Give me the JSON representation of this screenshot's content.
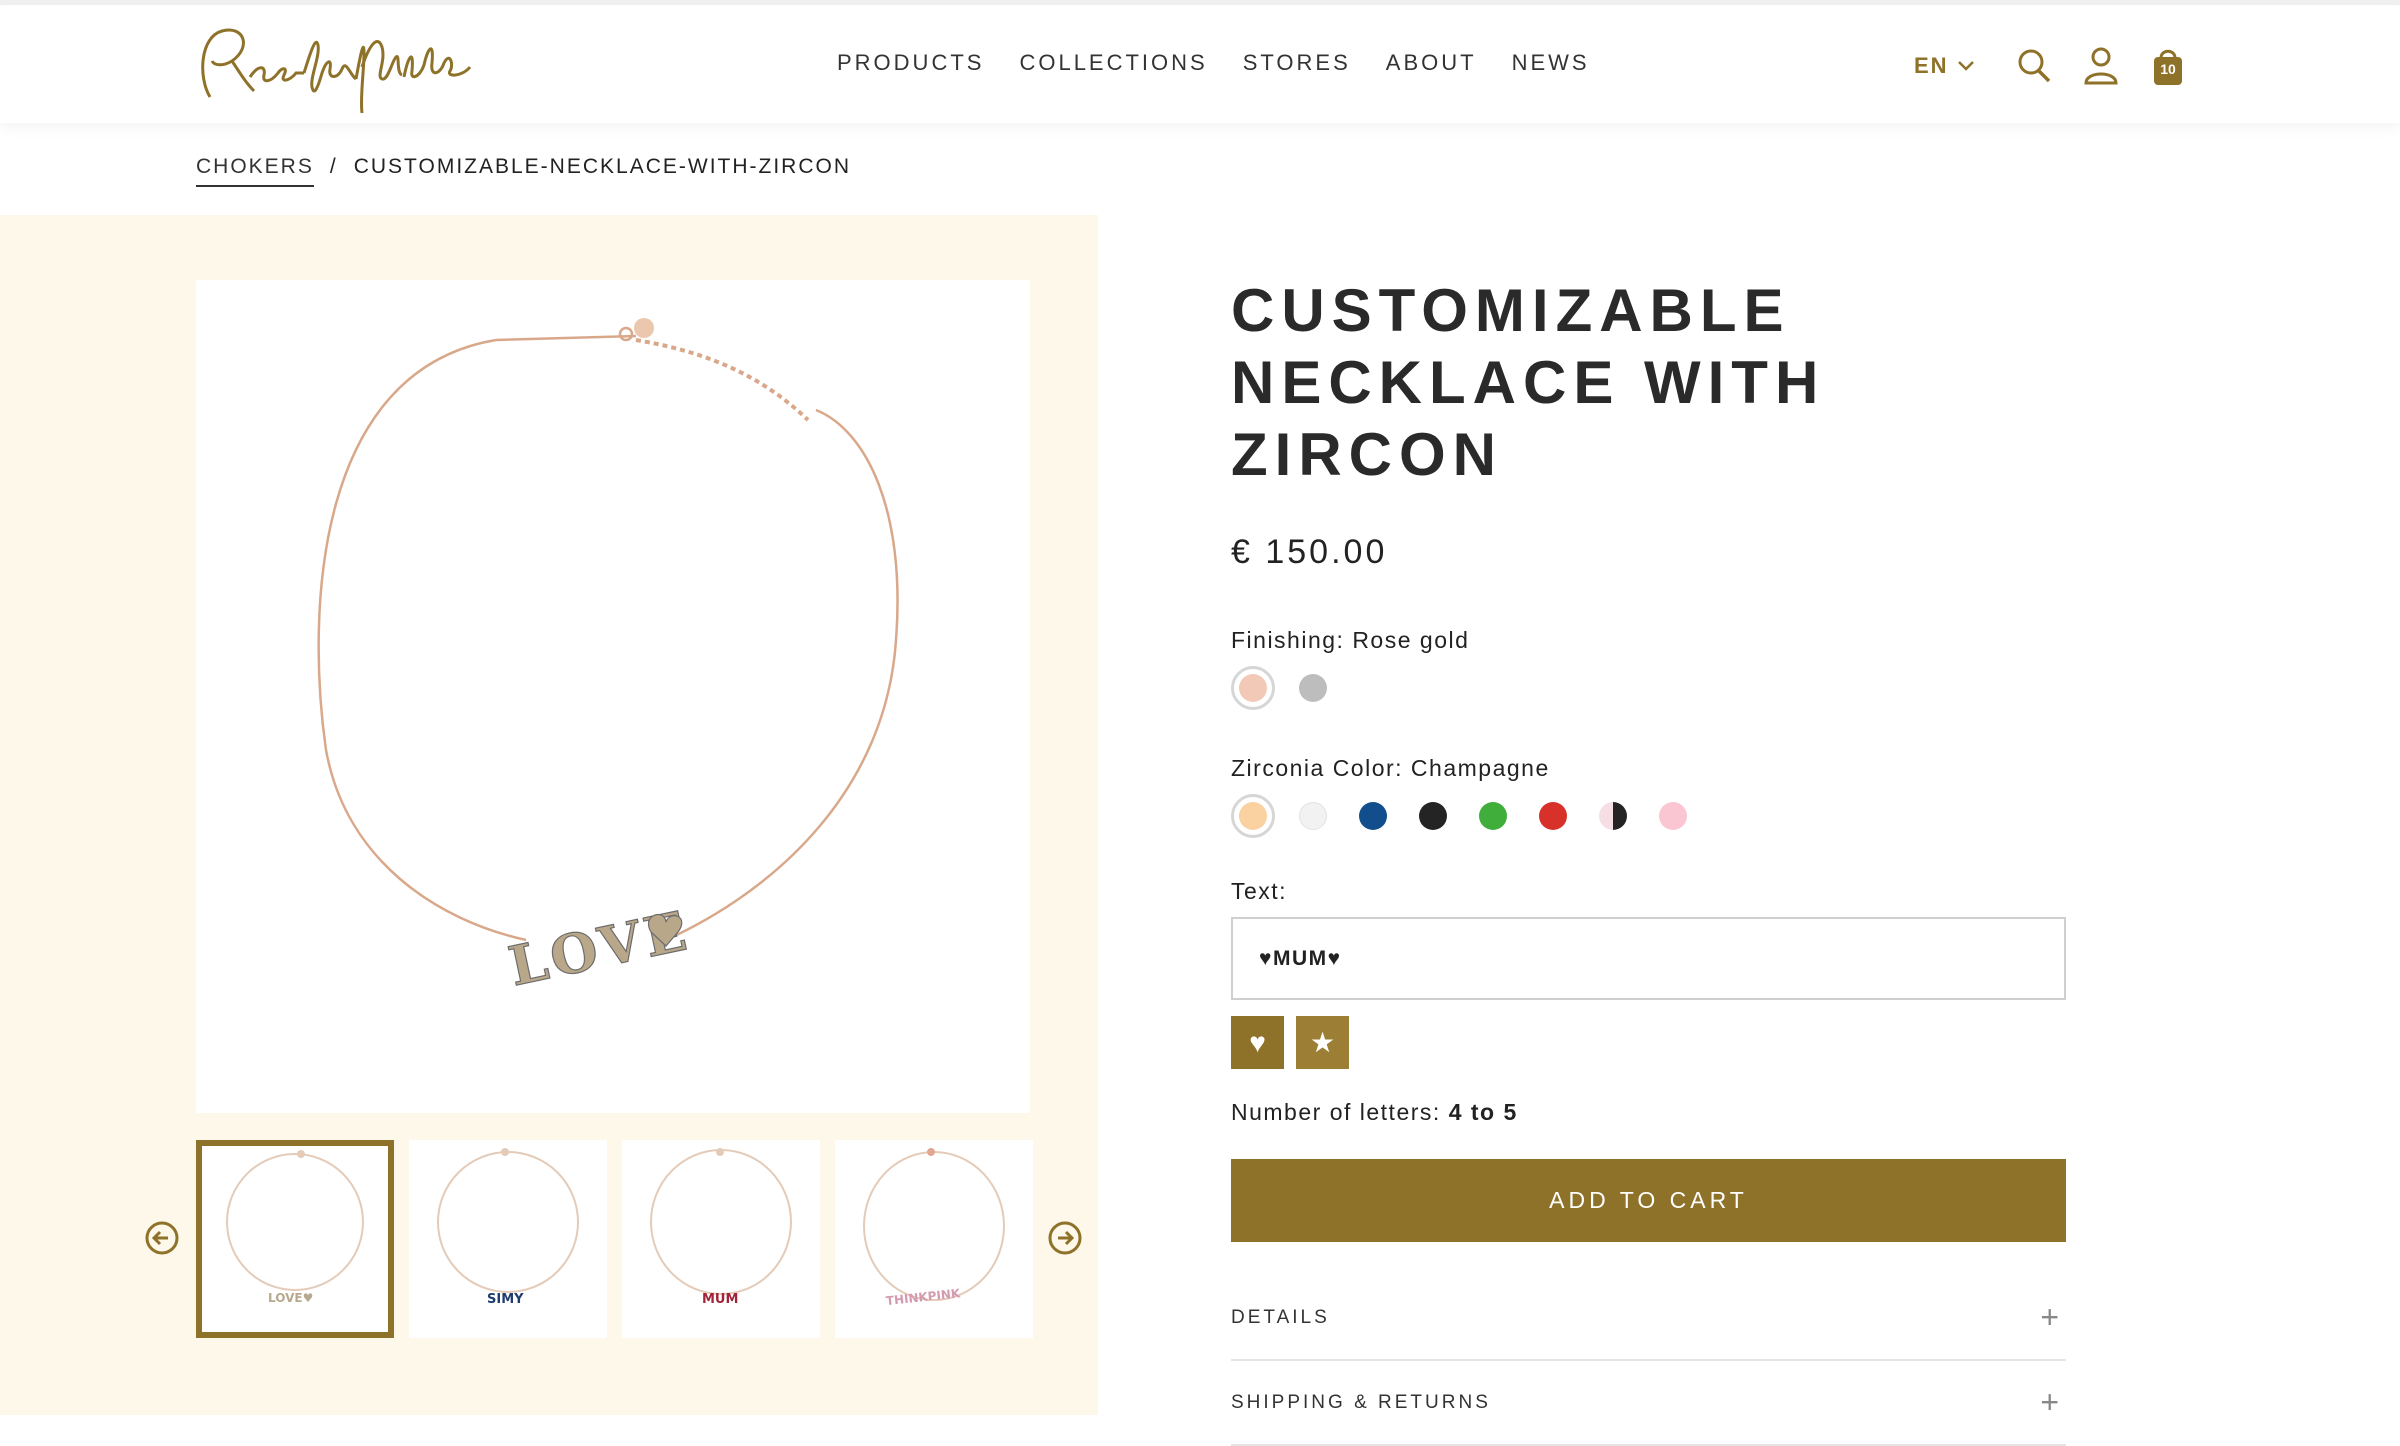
{
  "header": {
    "brand": "Rue des Mille",
    "nav": [
      "PRODUCTS",
      "COLLECTIONS",
      "STORES",
      "ABOUT",
      "NEWS"
    ],
    "language": "EN",
    "cart_count": "10"
  },
  "breadcrumb": {
    "parent": "CHOKERS",
    "separator": "/",
    "current": "CUSTOMIZABLE-NECKLACE-WITH-ZIRCON"
  },
  "gallery": {
    "thumbnail_texts": [
      "LOVE♥",
      "SIMY",
      "MUM",
      "THINKPINK"
    ],
    "main_image_text": "LOVE"
  },
  "product": {
    "title_line1": "CUSTOMIZABLE",
    "title_line2": "NECKLACE WITH ZIRCON",
    "price": "€ 150.00",
    "finishing_label": "Finishing: Rose gold",
    "finishing_swatches": [
      "#f2c9b7",
      "#bdbdbd"
    ],
    "zirconia_label": "Zirconia Color: Champagne",
    "zirconia_swatches": [
      "#fad1a1",
      "#f2f2f2",
      "#124e8c",
      "#242424",
      "#3fae3a",
      "#d7312a",
      "half",
      "#f9c6d2"
    ],
    "text_label": "Text:",
    "text_value": "♥MUM♥",
    "symbol_buttons": [
      "♥",
      "★"
    ],
    "letters_label": "Number of letters: ",
    "letters_range": "4 to 5",
    "add_to_cart": "ADD TO CART",
    "accordion": [
      "DETAILS",
      "SHIPPING & RETURNS"
    ]
  },
  "colors": {
    "accent": "#8f7229",
    "gallery_bg": "#fdf8e9"
  }
}
